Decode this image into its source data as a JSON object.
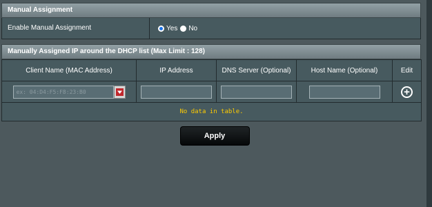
{
  "manual": {
    "title": "Manual Assignment",
    "enable_label": "Enable Manual Assignment",
    "yes": "Yes",
    "no": "No",
    "selected": "Yes"
  },
  "list": {
    "title": "Manually Assigned IP around the DHCP list (Max Limit : 128)",
    "columns": [
      "Client Name (MAC Address)",
      "IP Address",
      "DNS Server (Optional)",
      "Host Name (Optional)",
      "Edit"
    ],
    "mac_placeholder": "ex: 04:D4:F5:F8:23:B0",
    "empty_text": "No data in table."
  },
  "apply_label": "Apply",
  "colors": {
    "background": "#4d595d",
    "header": "#92a0a5",
    "empty_text": "#ffcc00",
    "radio_on": "#1a73e8"
  },
  "icons": {
    "dropdown": "red-arrow-down-icon",
    "add": "plus-circle-icon"
  }
}
